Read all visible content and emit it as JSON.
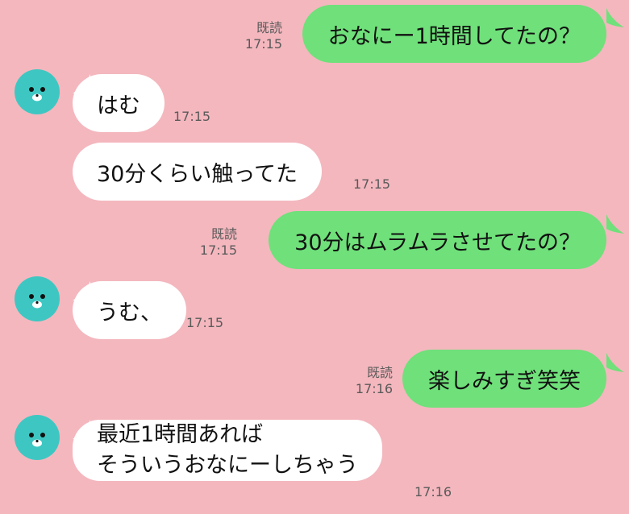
{
  "colors": {
    "background": "#F4B7BE",
    "sent_bubble": "#6FE07A",
    "received_bubble": "#FFFFFF",
    "avatar": "#3EC7C2"
  },
  "avatar_icon": "seal-avatar-icon",
  "messages": [
    {
      "read_label": "既読",
      "time": "17:15",
      "text": "おなにー1時間してたの？"
    },
    {
      "time": "17:15",
      "text": "はむ"
    },
    {
      "time": "17:15",
      "text": "30分くらい触ってた"
    },
    {
      "read_label": "既読",
      "time": "17:15",
      "text": "30分はムラムラさせてたの？"
    },
    {
      "time": "17:15",
      "text": "うむ、"
    },
    {
      "read_label": "既読",
      "time": "17:16",
      "text": "楽しみすぎ笑笑"
    },
    {
      "time": "17:16",
      "line1": "最近1時間あれば",
      "line2": "そういうおなにーしちゃう"
    }
  ]
}
